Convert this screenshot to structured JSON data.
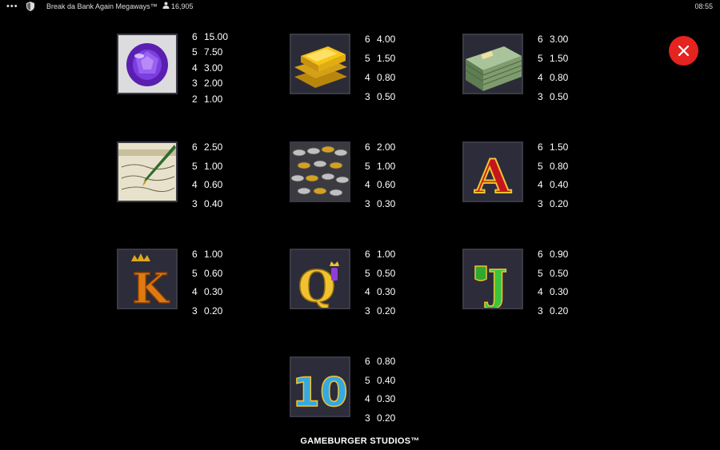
{
  "topbar": {
    "dots": "•••",
    "game_title": "Break da Bank Again Megaways™",
    "players": "16,905",
    "clock": "08:55"
  },
  "symbols": [
    {
      "name": "amethyst",
      "pays": [
        [
          "6",
          "15.00"
        ],
        [
          "5",
          "7.50"
        ],
        [
          "4",
          "3.00"
        ],
        [
          "3",
          "2.00"
        ],
        [
          "2",
          "1.00"
        ]
      ]
    },
    {
      "name": "gold-bars",
      "pays": [
        [
          "6",
          "4.00"
        ],
        [
          "5",
          "1.50"
        ],
        [
          "4",
          "0.80"
        ],
        [
          "3",
          "0.50"
        ]
      ]
    },
    {
      "name": "cash-stack",
      "pays": [
        [
          "6",
          "3.00"
        ],
        [
          "5",
          "1.50"
        ],
        [
          "4",
          "0.80"
        ],
        [
          "3",
          "0.50"
        ]
      ]
    },
    {
      "name": "cheque-pen",
      "pays": [
        [
          "6",
          "2.50"
        ],
        [
          "5",
          "1.00"
        ],
        [
          "4",
          "0.60"
        ],
        [
          "3",
          "0.40"
        ]
      ]
    },
    {
      "name": "coins",
      "pays": [
        [
          "6",
          "2.00"
        ],
        [
          "5",
          "1.00"
        ],
        [
          "4",
          "0.60"
        ],
        [
          "3",
          "0.30"
        ]
      ]
    },
    {
      "name": "letter-a",
      "letter": "A",
      "pays": [
        [
          "6",
          "1.50"
        ],
        [
          "5",
          "0.80"
        ],
        [
          "4",
          "0.40"
        ],
        [
          "3",
          "0.20"
        ]
      ]
    },
    {
      "name": "letter-k",
      "letter": "K",
      "pays": [
        [
          "6",
          "1.00"
        ],
        [
          "5",
          "0.60"
        ],
        [
          "4",
          "0.30"
        ],
        [
          "3",
          "0.20"
        ]
      ]
    },
    {
      "name": "letter-q",
      "letter": "Q",
      "pays": [
        [
          "6",
          "1.00"
        ],
        [
          "5",
          "0.50"
        ],
        [
          "4",
          "0.30"
        ],
        [
          "3",
          "0.20"
        ]
      ]
    },
    {
      "name": "letter-j",
      "letter": "J",
      "pays": [
        [
          "6",
          "0.90"
        ],
        [
          "5",
          "0.50"
        ],
        [
          "4",
          "0.30"
        ],
        [
          "3",
          "0.20"
        ]
      ]
    },
    {
      "name": "number-10",
      "letter": "10",
      "pays": [
        [
          "6",
          "0.80"
        ],
        [
          "5",
          "0.40"
        ],
        [
          "4",
          "0.30"
        ],
        [
          "3",
          "0.20"
        ]
      ]
    }
  ],
  "footer": "GAMEBURGER STUDIOS™",
  "colors": {
    "close": "#e5231f",
    "background": "#000000",
    "tile": "#2a2a35"
  }
}
